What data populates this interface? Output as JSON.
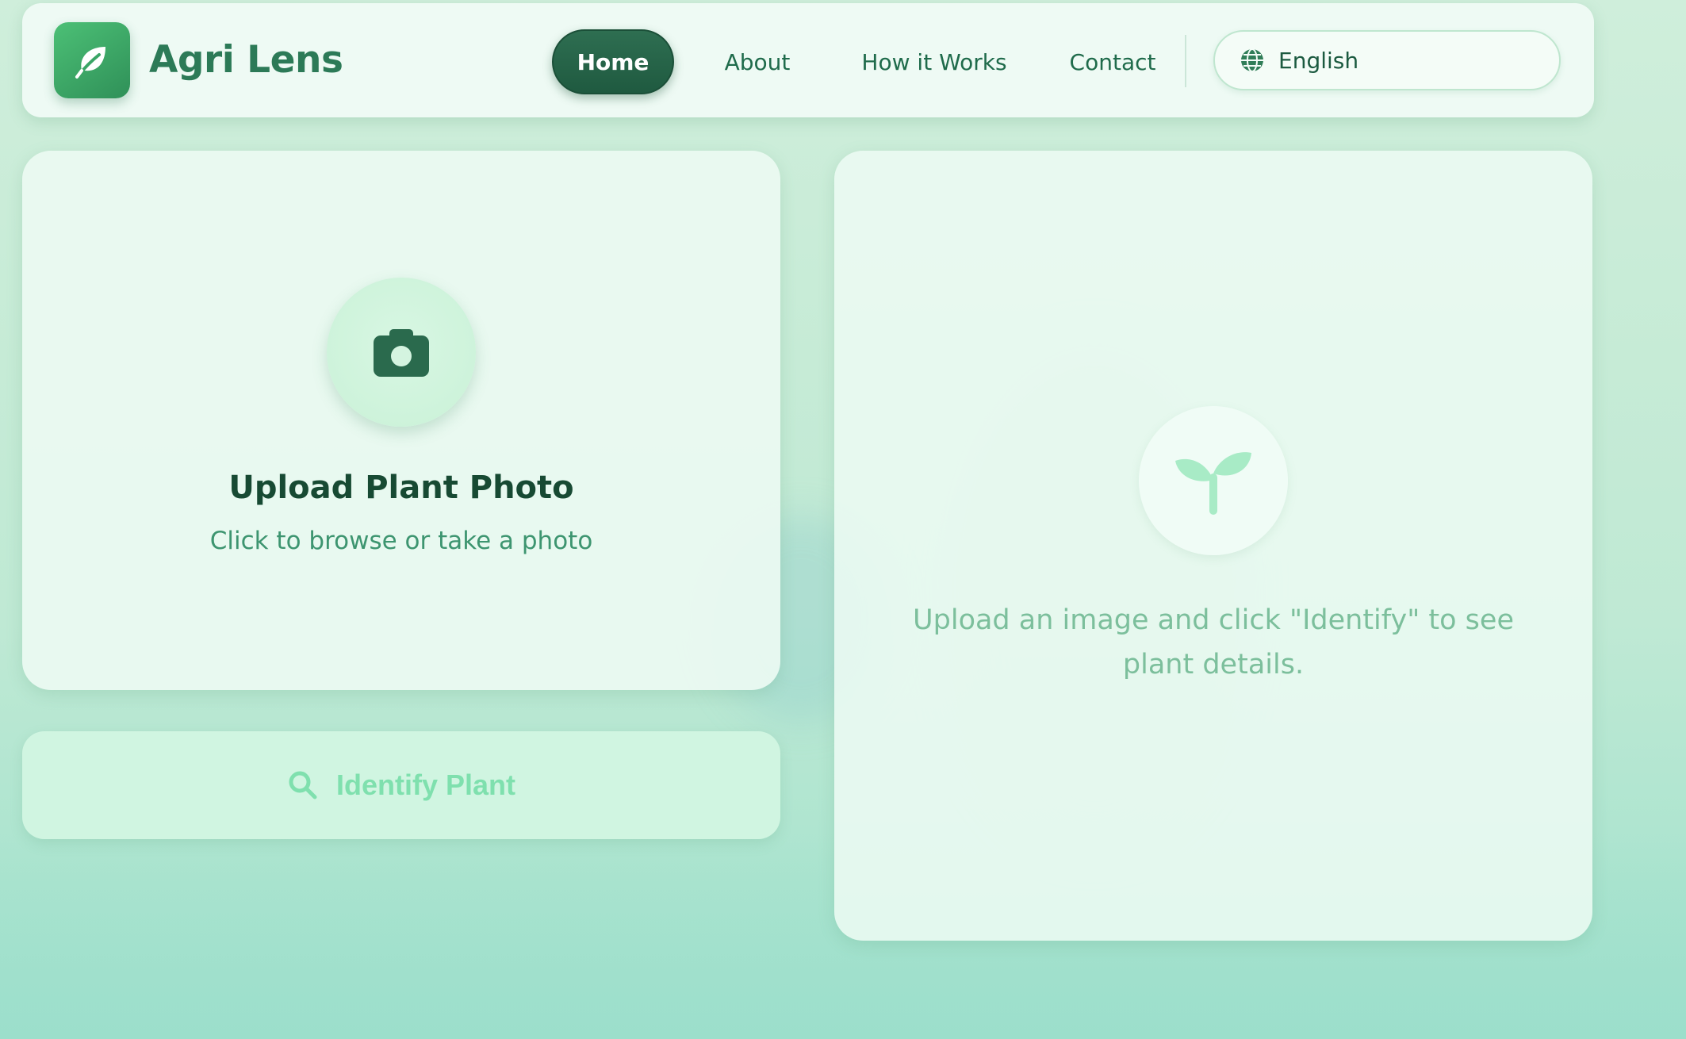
{
  "app": {
    "name": "Agri Lens",
    "logo_icon": "leaf-icon"
  },
  "nav": {
    "items": [
      {
        "label": "Home",
        "active": true
      },
      {
        "label": "About",
        "active": false
      },
      {
        "label": "How it Works",
        "active": false
      },
      {
        "label": "Contact",
        "active": false
      }
    ]
  },
  "language": {
    "selected": "English",
    "icon": "globe-icon"
  },
  "upload": {
    "icon": "camera-icon",
    "title": "Upload Plant Photo",
    "subtitle": "Click to browse or take a photo"
  },
  "identify": {
    "icon": "search-icon",
    "label": "Identify Plant"
  },
  "result": {
    "icon": "sprout-icon",
    "placeholder": "Upload an image and click \"Identify\" to see plant details."
  },
  "colors": {
    "brand": "#2c7a57",
    "accent": "#1f5a40",
    "muted_green": "#7fe0ae"
  }
}
